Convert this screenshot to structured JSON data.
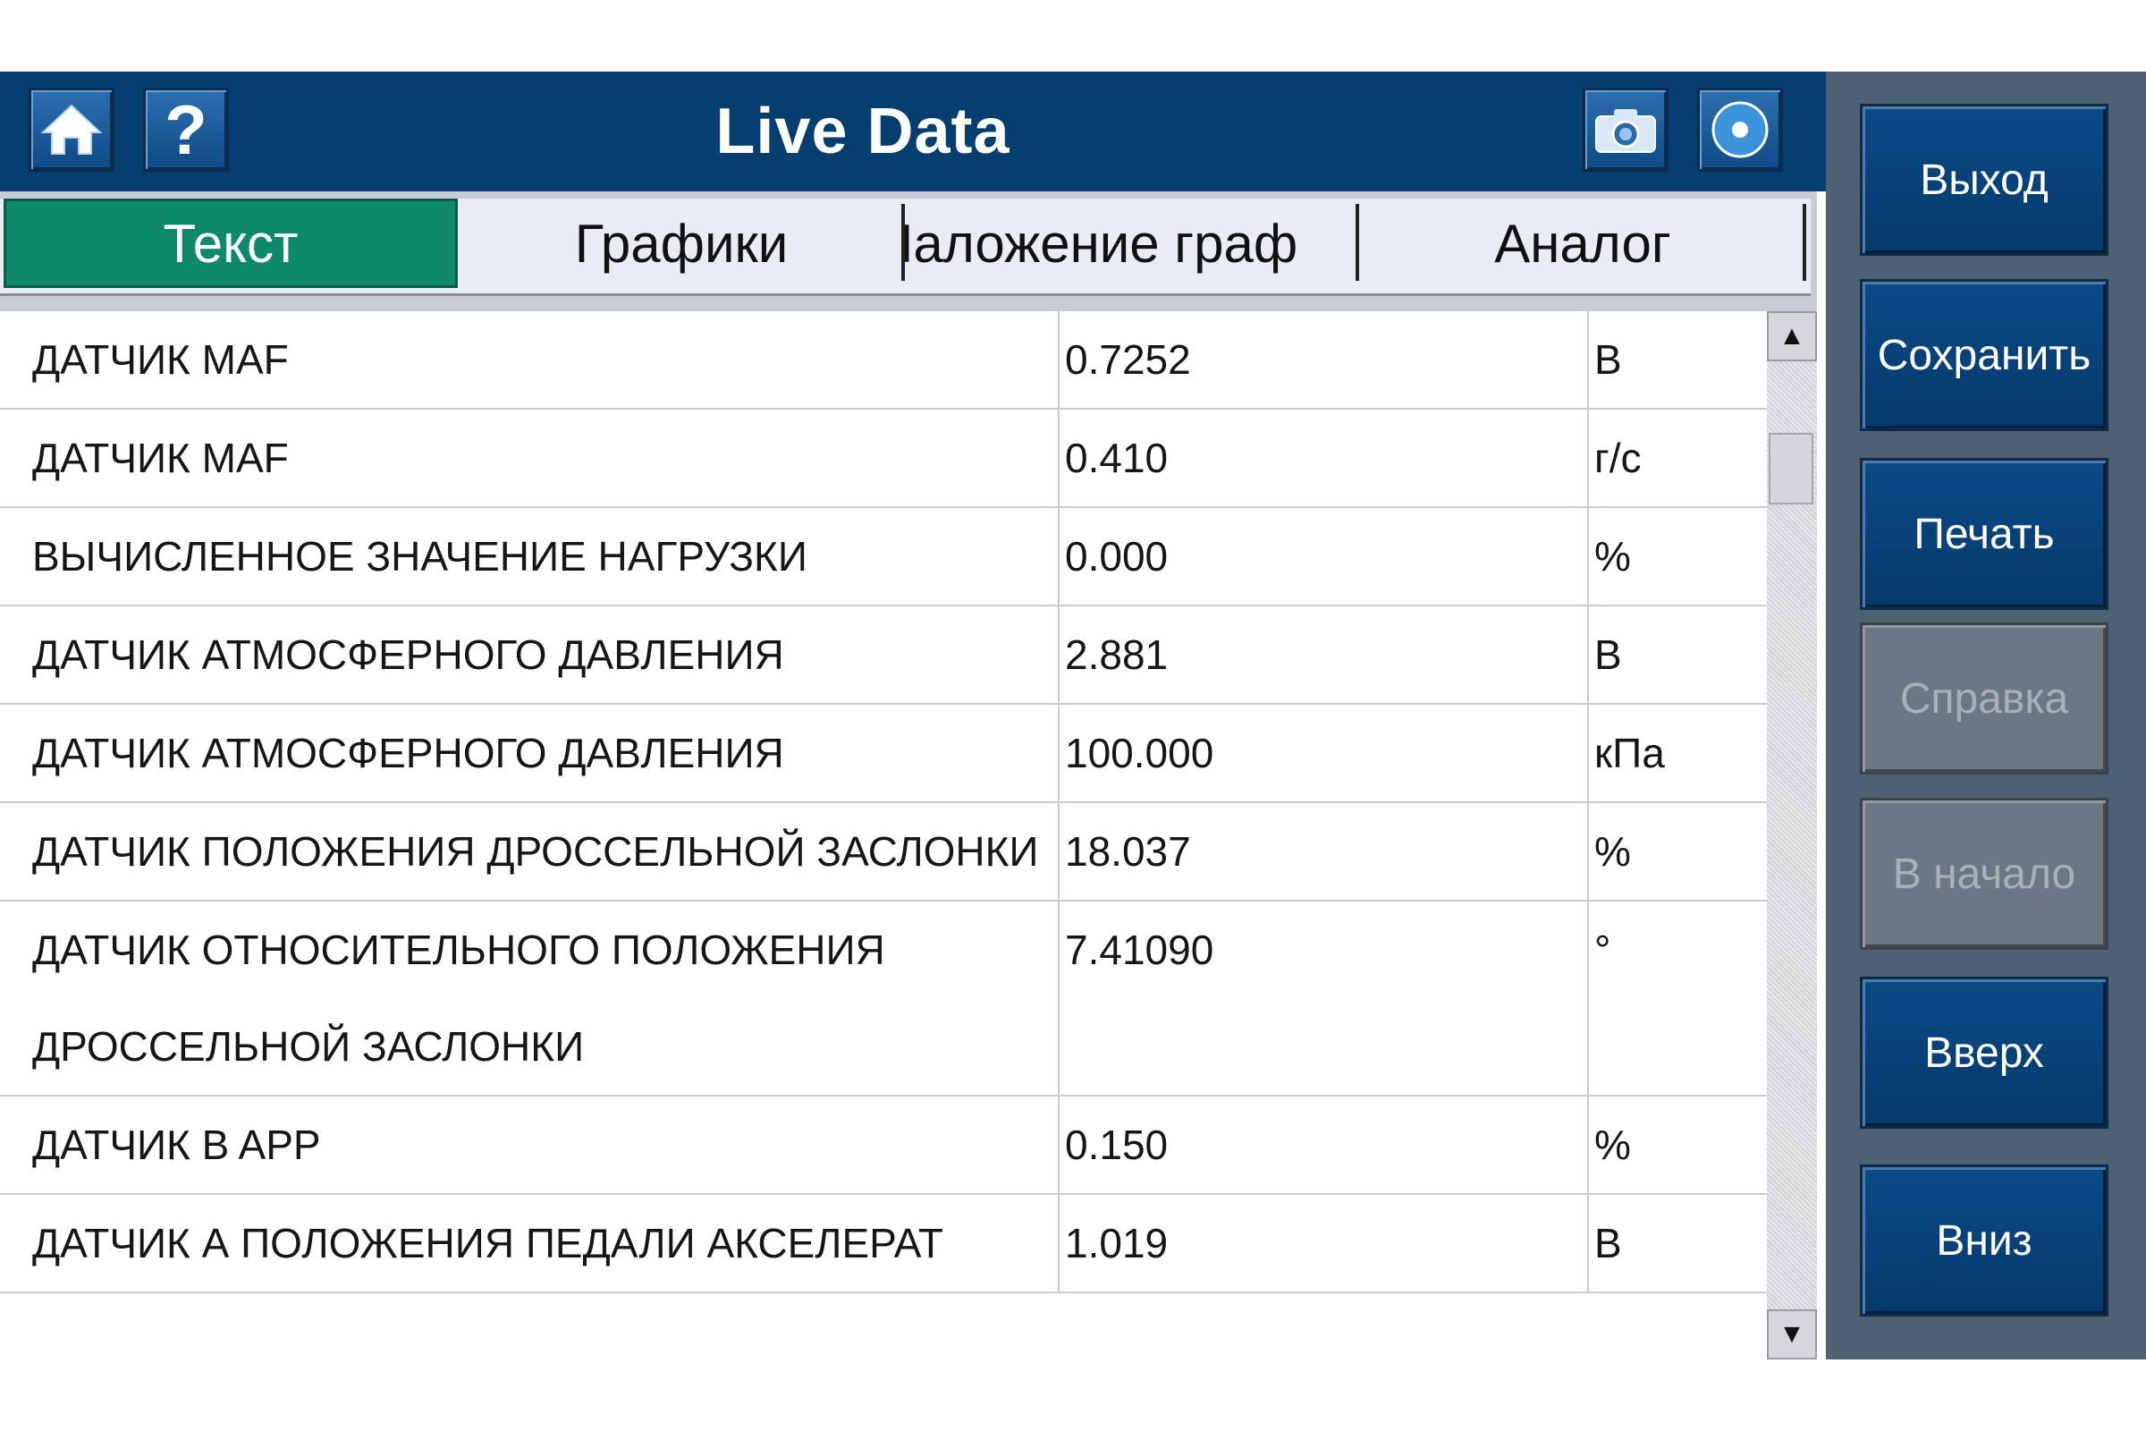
{
  "header": {
    "title": "Live Data",
    "icons": [
      "home-icon",
      "help-icon",
      "camera-icon",
      "record-icon"
    ],
    "help_glyph": "?"
  },
  "tabs": [
    {
      "label": "Текст",
      "active": true
    },
    {
      "label": "Графики",
      "active": false
    },
    {
      "label": "Наложение граф",
      "active": false
    },
    {
      "label": "Аналог",
      "active": false
    }
  ],
  "rows": [
    {
      "name": "ДАТЧИК MAF",
      "value": "0.7252",
      "unit": "В"
    },
    {
      "name": "ДАТЧИК MAF",
      "value": "0.410",
      "unit": "г/с"
    },
    {
      "name": "ВЫЧИСЛЕННОЕ ЗНАЧЕНИЕ НАГРУЗКИ",
      "value": "0.000",
      "unit": "%"
    },
    {
      "name": "ДАТЧИК АТМОСФЕРНОГО ДАВЛЕНИЯ",
      "value": "2.881",
      "unit": "В"
    },
    {
      "name": "ДАТЧИК АТМОСФЕРНОГО ДАВЛЕНИЯ",
      "value": "100.000",
      "unit": "кПа"
    },
    {
      "name": "ДАТЧИК ПОЛОЖЕНИЯ ДРОССЕЛЬНОЙ ЗАСЛОНКИ",
      "value": "18.037",
      "unit": "%"
    },
    {
      "name": "ДАТЧИК ОТНОСИТЕЛЬНОГО ПОЛОЖЕНИЯ ДРОССЕЛЬНОЙ ЗАСЛОНКИ",
      "value": "7.41090",
      "unit": "°"
    },
    {
      "name": "ДАТЧИК B APP",
      "value": "0.150",
      "unit": "%"
    },
    {
      "name": "ДАТЧИК А ПОЛОЖЕНИЯ ПЕДАЛИ АКСЕЛЕРАТ",
      "value": "1.019",
      "unit": "В"
    }
  ],
  "scrollbar": {
    "up_glyph": "▲",
    "down_glyph": "▼"
  },
  "side_buttons": [
    {
      "label": "Выход",
      "enabled": true
    },
    {
      "label": "Сохранить",
      "enabled": true
    },
    {
      "label": "Печать",
      "enabled": true
    },
    {
      "label": "Справка",
      "enabled": false
    },
    {
      "label": "В начало",
      "enabled": false
    },
    {
      "label": "Вверх",
      "enabled": true
    },
    {
      "label": "Вниз",
      "enabled": true
    }
  ],
  "colors": {
    "header_bg": "#063e70",
    "active_tab": "#0e8a6a",
    "side_panel": "#4e6172",
    "button_bg": "#0b4a86"
  }
}
